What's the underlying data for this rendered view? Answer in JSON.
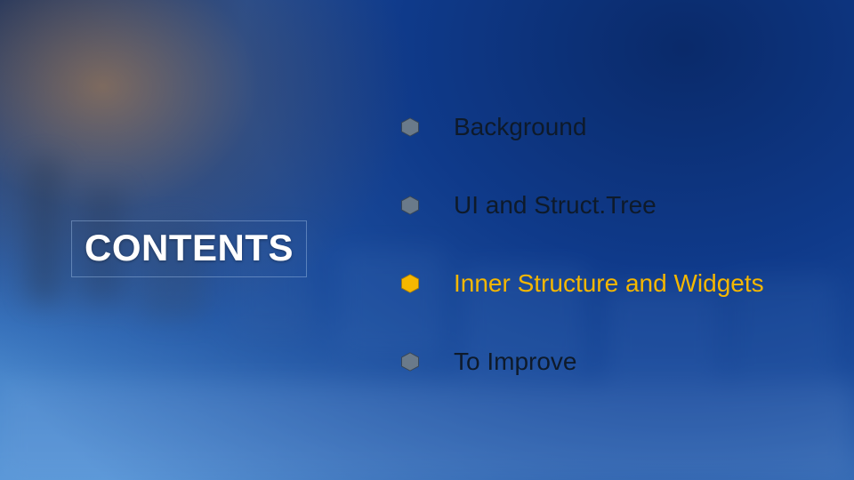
{
  "title": "CONTENTS",
  "colors": {
    "hex_muted": "#6a7a8a",
    "hex_highlight": "#f5b700",
    "text_default": "#0e1a2a",
    "text_highlight": "#f5b700"
  },
  "items": [
    {
      "label": "Background",
      "highlight": false
    },
    {
      "label": "UI and Struct.Tree",
      "highlight": false
    },
    {
      "label": "Inner Structure and Widgets",
      "highlight": true
    },
    {
      "label": "To Improve",
      "highlight": false
    }
  ]
}
